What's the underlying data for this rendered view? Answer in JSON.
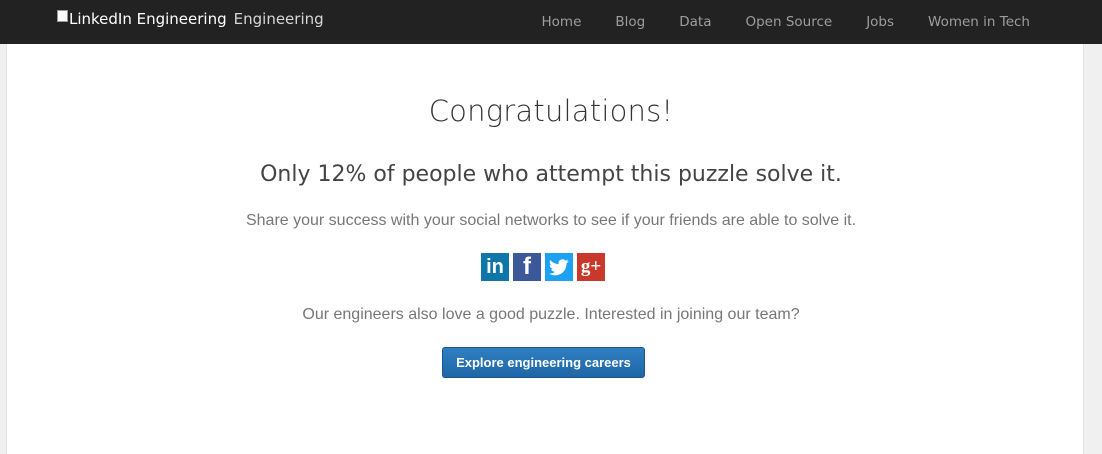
{
  "navbar": {
    "logo_alt": "LinkedIn Engineering",
    "brand_text": "Engineering",
    "links": [
      "Home",
      "Blog",
      "Data",
      "Open Source",
      "Jobs",
      "Women in Tech"
    ]
  },
  "main": {
    "title": "Congratulations!",
    "subtitle": "Only 12% of people who attempt this puzzle solve it.",
    "share_text": "Share your success with your social networks to see if your friends are able to solve it.",
    "social": [
      {
        "name": "linkedin-icon",
        "glyph": "in",
        "color": "#0e76a8"
      },
      {
        "name": "facebook-icon",
        "glyph": "f",
        "color": "#3b5998"
      },
      {
        "name": "twitter-icon",
        "glyph": "bird",
        "color": "#1da1f2"
      },
      {
        "name": "google-plus-icon",
        "glyph": "g+",
        "color": "#c8392b"
      }
    ],
    "join_text": "Our engineers also love a good puzzle. Interested in joining our team?",
    "cta_label": "Explore engineering careers"
  }
}
